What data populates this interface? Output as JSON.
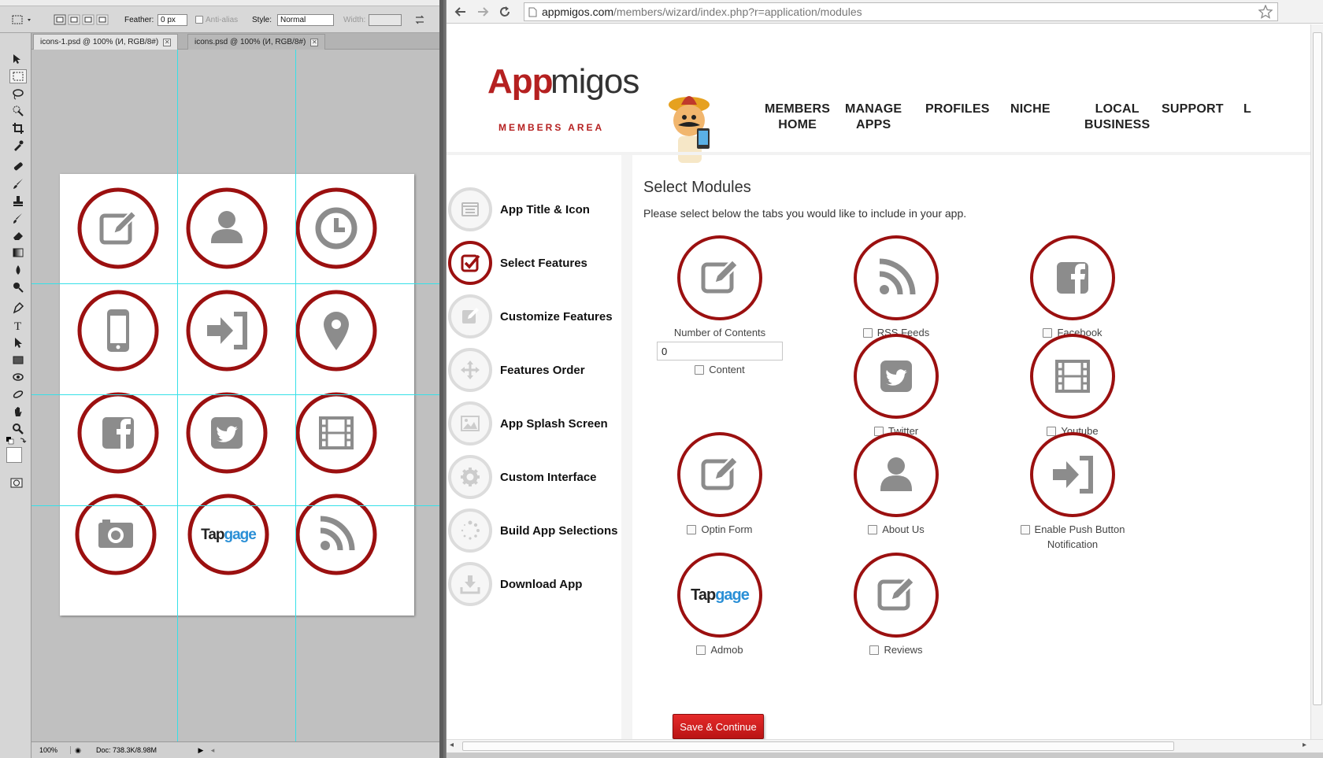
{
  "photoshop": {
    "options_bar": {
      "feather_label": "Feather:",
      "feather_value": "0 px",
      "anti_alias_label": "Anti-alias",
      "style_label": "Style:",
      "style_value": "Normal",
      "width_label": "Width:"
    },
    "tabs": [
      {
        "label": "icons-1.psd @ 100% (И, RGB/8#)",
        "active": true
      },
      {
        "label": "icons.psd @ 100% (И, RGB/8#)",
        "active": false
      }
    ],
    "status": {
      "zoom": "100%",
      "doc": "Doc: 738.3K/8.98M"
    },
    "tapgage_text": "Tapgage"
  },
  "browser": {
    "url_domain": "appmigos.com",
    "url_path": "/members/wizard/index.php?r=application/modules"
  },
  "site": {
    "logo_app": "App",
    "logo_migos": "migos",
    "logo_subtitle": "MEMBERS AREA",
    "nav": [
      {
        "line1": "MEMBERS",
        "line2": "HOME"
      },
      {
        "line1": "MANAGE",
        "line2": "APPS"
      },
      {
        "line1": "PROFILES",
        "line2": ""
      },
      {
        "line1": "NICHE",
        "line2": ""
      },
      {
        "line1": "LOCAL",
        "line2": "BUSINESS"
      },
      {
        "line1": "SUPPORT",
        "line2": ""
      },
      {
        "line1": "L",
        "line2": ""
      }
    ]
  },
  "sidebar": {
    "steps": [
      {
        "label": "App Title & Icon",
        "icon": "list-icon",
        "active": false
      },
      {
        "label": "Select Features",
        "icon": "checkbox-icon",
        "active": true
      },
      {
        "label": "Customize Features",
        "icon": "edit-icon",
        "active": false
      },
      {
        "label": "Features Order",
        "icon": "move-icon",
        "active": false
      },
      {
        "label": "App Splash Screen",
        "icon": "image-icon",
        "active": false
      },
      {
        "label": "Custom Interface",
        "icon": "gear-icon",
        "active": false
      },
      {
        "label": "Build App Selections",
        "icon": "spinner-icon",
        "active": false
      },
      {
        "label": "Download App",
        "icon": "download-icon",
        "active": false
      }
    ]
  },
  "content": {
    "title": "Select Modules",
    "subtitle": "Please select below the tabs you would like to include in your app.",
    "number_of_contents_label": "Number of Contents",
    "number_of_contents_value": "0",
    "modules": {
      "content": "Content",
      "rss": "RSS Feeds",
      "facebook": "Facebook",
      "twitter": "Twitter",
      "youtube": "Youtube",
      "optin": "Optin Form",
      "about": "About Us",
      "push_line1": "Enable Push Button",
      "push_line2": "Notification",
      "admob": "Admob",
      "reviews": "Reviews"
    },
    "tapgage_text": "Tapgage",
    "save_button": "Save & Continue"
  },
  "colors": {
    "brand_red": "#9b1010",
    "icon_gray": "#8c8c8c",
    "tapgage_blue": "#2a8fd6"
  }
}
